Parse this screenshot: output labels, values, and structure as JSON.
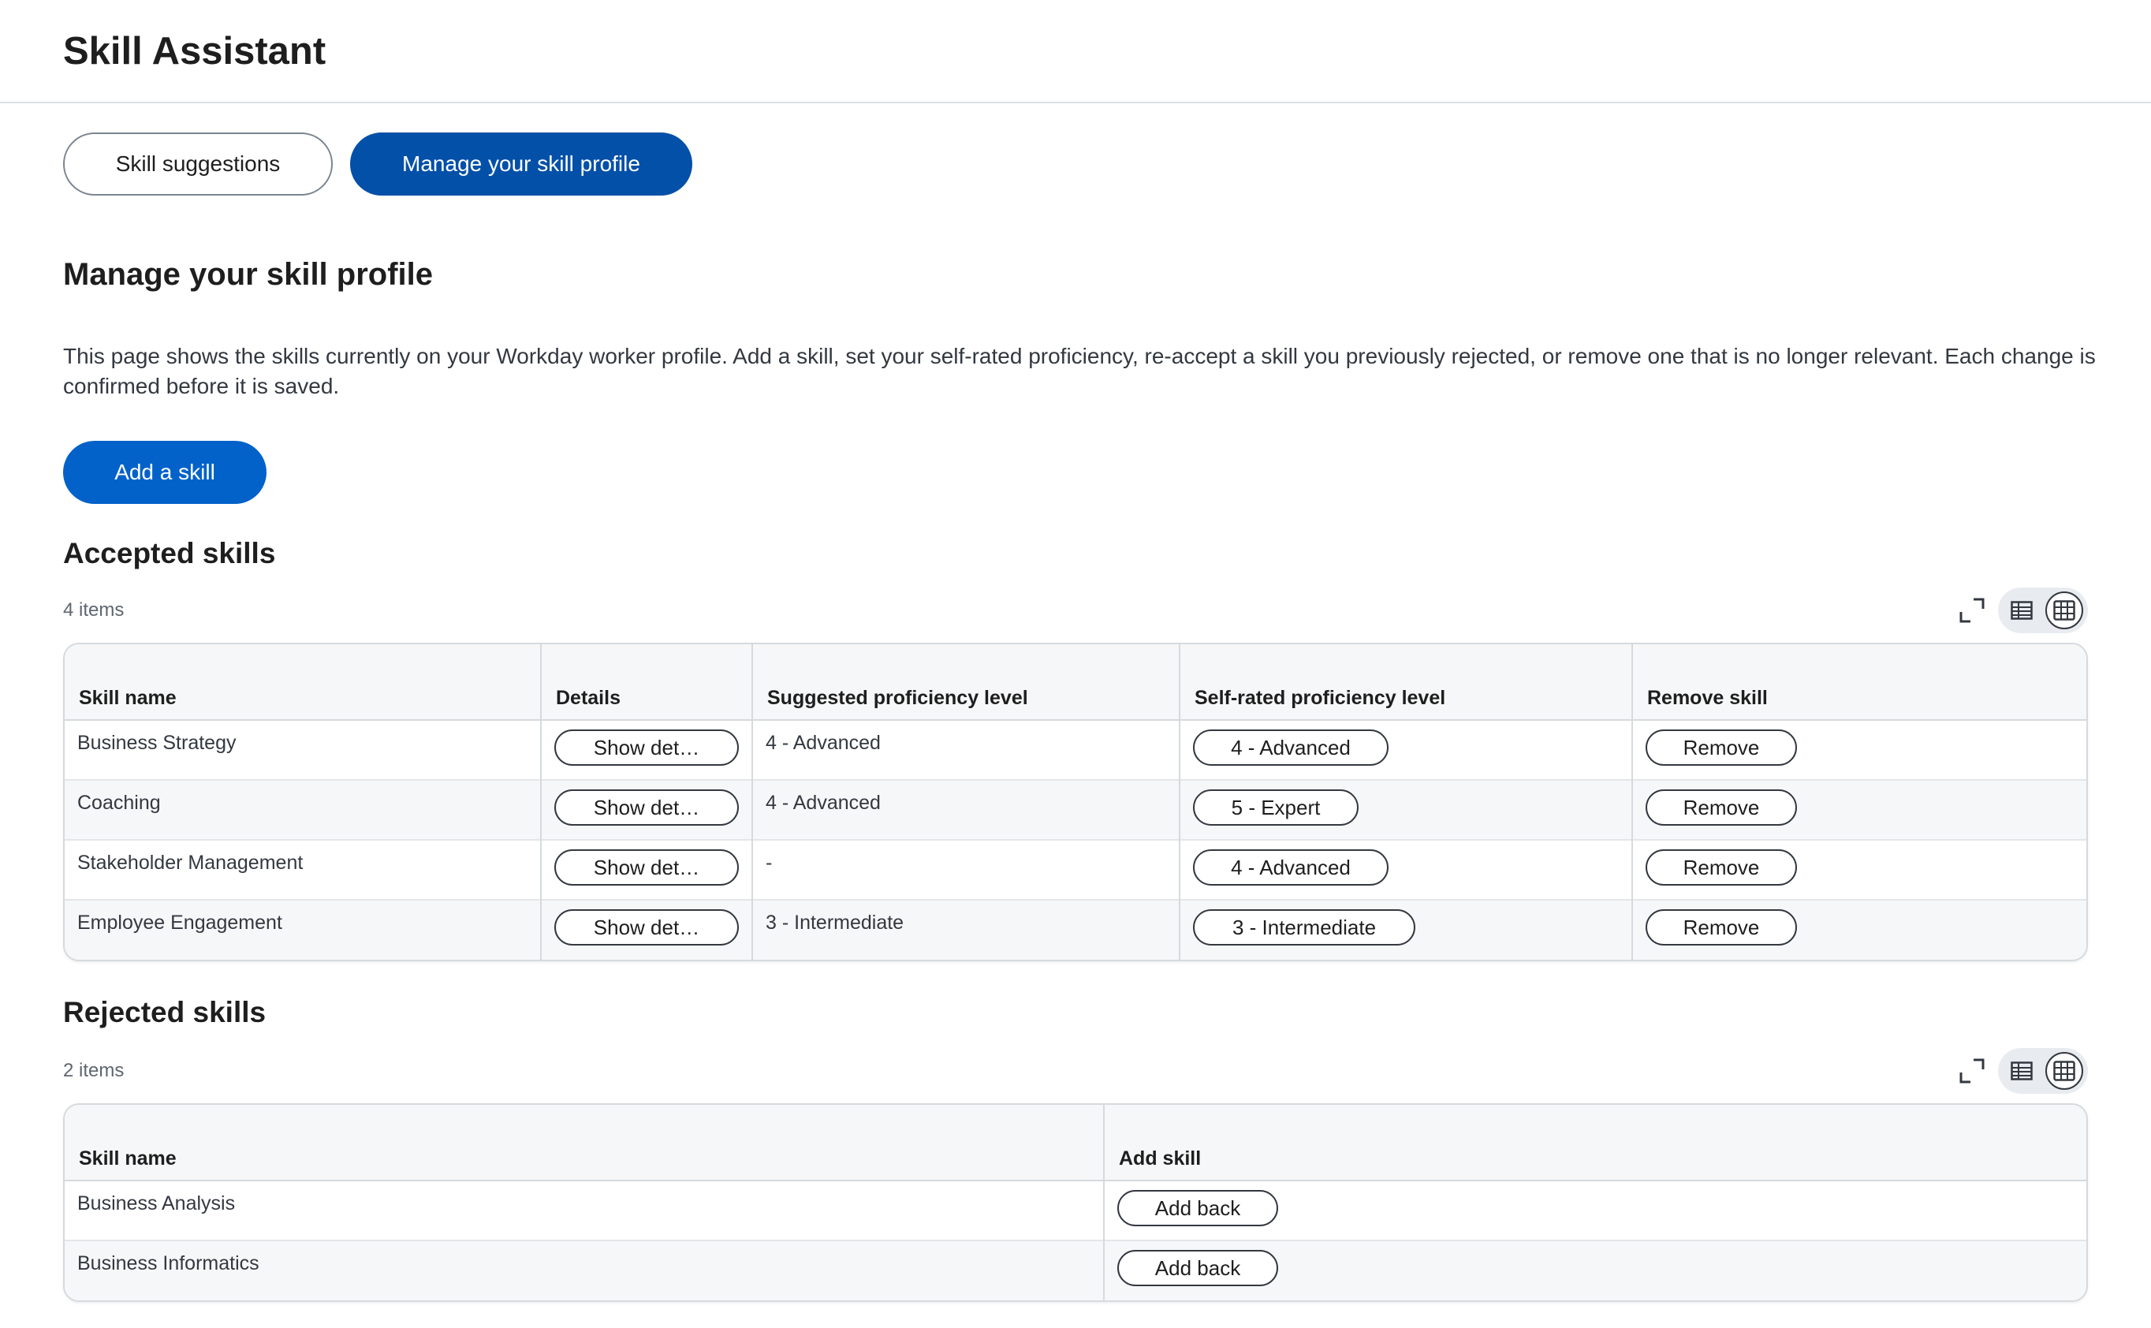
{
  "app": {
    "title": "Skill Assistant"
  },
  "tabs": [
    {
      "label": "Skill suggestions",
      "active": false
    },
    {
      "label": "Manage your skill profile",
      "active": true
    }
  ],
  "section": {
    "title": "Manage your skill profile",
    "description": "This page shows the skills currently on your Workday worker profile. Add a skill, set your self-rated proficiency, re-accept a skill you previously rejected, or remove one that is no longer relevant. Each change is confirmed before it is saved.",
    "add_button": "Add a skill"
  },
  "accepted": {
    "title": "Accepted skills",
    "count": "4 items",
    "columns": [
      "Skill name",
      "Details",
      "Suggested proficiency level",
      "Self-rated proficiency level",
      "Remove skill"
    ],
    "rows": [
      {
        "name": "Business Strategy",
        "details": "Show det…",
        "suggested": "4 - Advanced",
        "self_rated": "4 - Advanced",
        "remove": "Remove"
      },
      {
        "name": "Coaching",
        "details": "Show det…",
        "suggested": "4 - Advanced",
        "self_rated": "5 - Expert",
        "remove": "Remove"
      },
      {
        "name": "Stakeholder Management",
        "details": "Show det…",
        "suggested": "-",
        "self_rated": "4 - Advanced",
        "remove": "Remove"
      },
      {
        "name": "Employee Engagement",
        "details": "Show det…",
        "suggested": "3 - Intermediate",
        "self_rated": "3 - Intermediate",
        "remove": "Remove"
      }
    ]
  },
  "rejected": {
    "title": "Rejected skills",
    "count": "2 items",
    "columns": [
      "Skill name",
      "Add skill"
    ],
    "rows": [
      {
        "name": "Business Analysis",
        "action": "Add back"
      },
      {
        "name": "Business Informatics",
        "action": "Add back"
      }
    ]
  },
  "icons": {
    "expand": "expand-icon",
    "table_view": "table-view-icon",
    "grid_view": "grid-view-icon"
  },
  "colors": {
    "primary": "#0262c9",
    "active_tab": "#0350a8",
    "border": "#d5dade"
  }
}
